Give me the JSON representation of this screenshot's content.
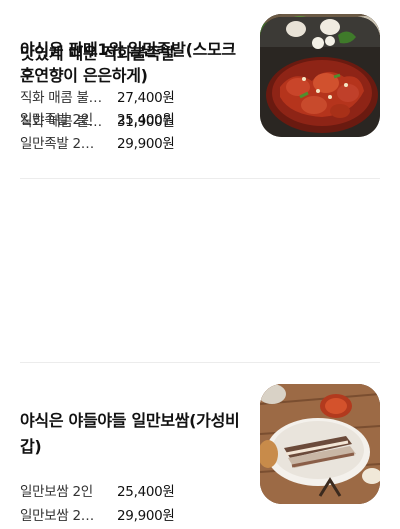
{
  "menu": {
    "items": [
      {
        "title": "야식은 판매1위 일만족발(스모크 훈연향이 은은하게)",
        "image_icon": "smoked-jokbal-photo",
        "options": [
          {
            "name": "일만족발 2인",
            "price": "25,400원"
          },
          {
            "name": "일만족발 2…",
            "price": "29,900원"
          }
        ]
      },
      {
        "title": "야식은 야들야들 일만보쌈(가성비 갑)",
        "image_icon": "bossam-photo",
        "options": [
          {
            "name": "일만보쌈 2인",
            "price": "25,400원"
          },
          {
            "name": "일만보쌈 2…",
            "price": "29,900원"
          }
        ]
      },
      {
        "title": "맛있게 매운 직화불족발",
        "image_icon": "spicy-grilled-jokbal-photo",
        "options": [
          {
            "name": "직화 매콤 불…",
            "price": "27,400원"
          },
          {
            "name": "직화 매콤 불…",
            "price": "31,900원"
          }
        ]
      }
    ]
  },
  "colors": {
    "text": "#111111",
    "divider": "#ececec",
    "background": "#ffffff"
  }
}
